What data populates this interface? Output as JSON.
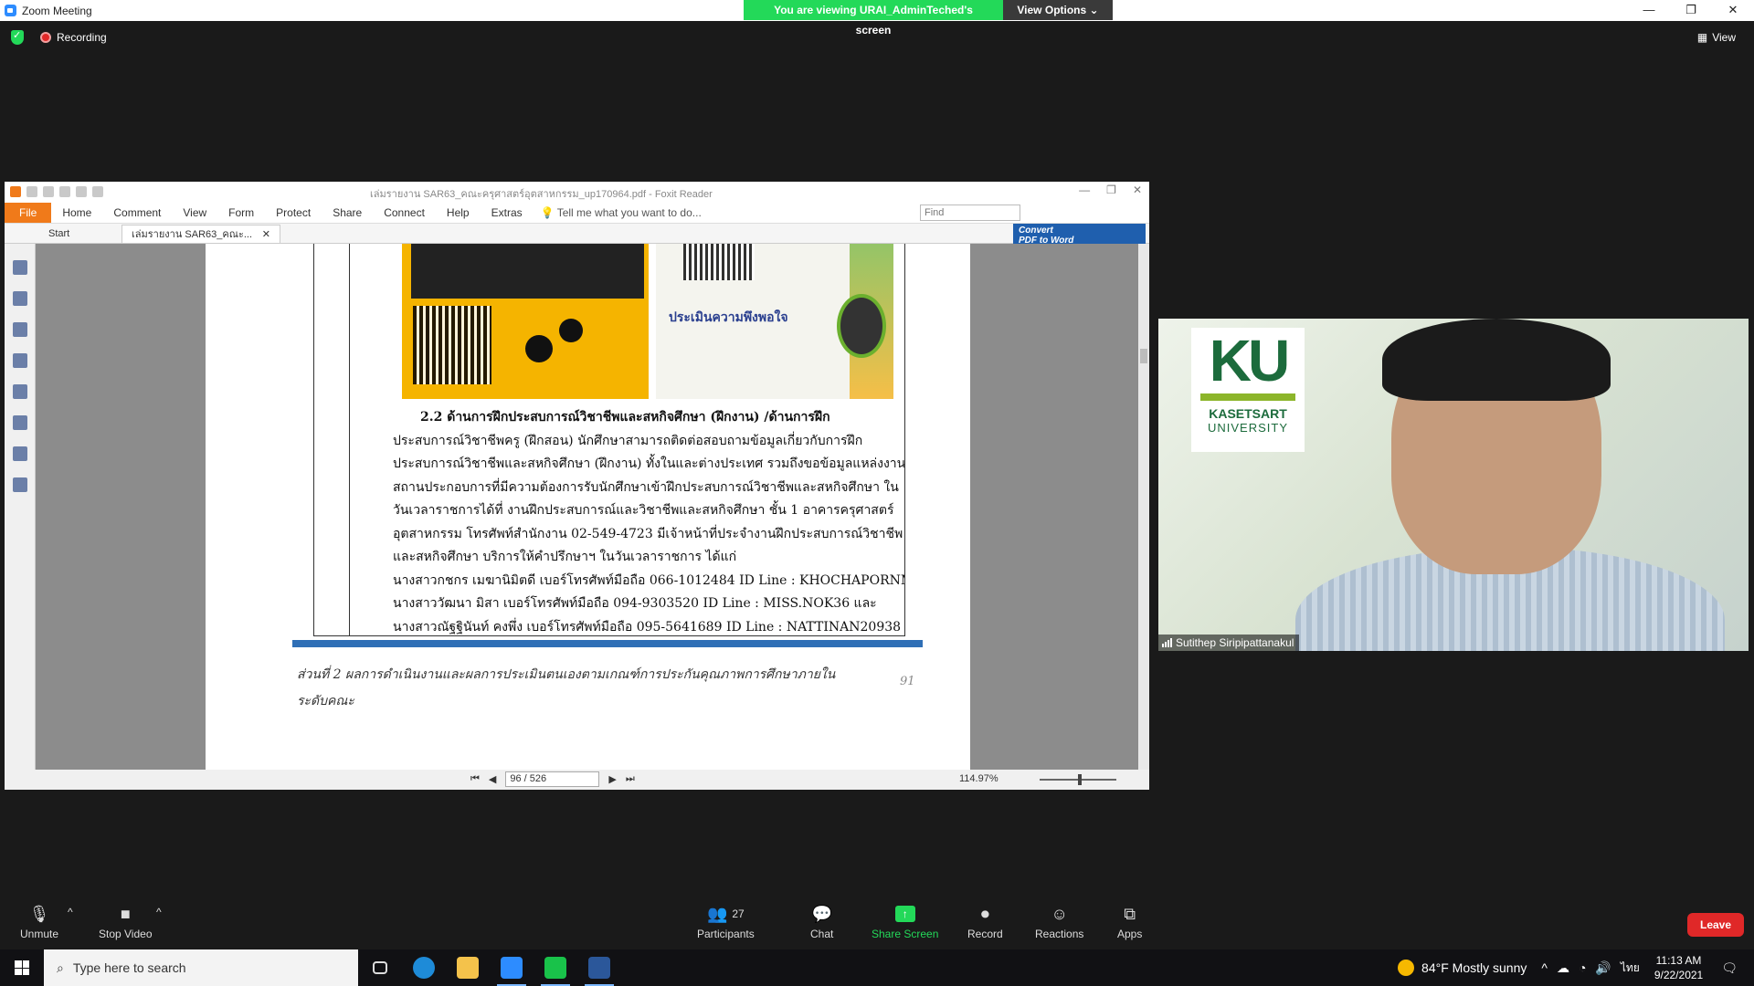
{
  "zoom": {
    "window_title": "Zoom Meeting",
    "share_banner": "You are viewing URAI_AdminTeched's screen",
    "view_options": "View Options",
    "recording_label": "Recording",
    "view_label": "View"
  },
  "foxit": {
    "title": "เล่มรายงาน SAR63_คณะครุศาสตร์อุตสาหกรรม_up170964.pdf - Foxit Reader",
    "menu": [
      "File",
      "Home",
      "Comment",
      "View",
      "Form",
      "Protect",
      "Share",
      "Connect",
      "Help",
      "Extras"
    ],
    "tell_me": "Tell me what you want to do...",
    "find_placeholder": "Find",
    "tabs": [
      {
        "label": "Start"
      },
      {
        "label": "เล่มรายงาน SAR63_คณะ..."
      }
    ],
    "convert_line1": "Convert",
    "convert_line2": "PDF to Word",
    "page_box": "96 / 526",
    "zoom_level": "114.97%"
  },
  "document": {
    "poster_right_headline": "ประเมินความพึงพอใจ",
    "lines": [
      "2.2 ด้านการฝึกประสบการณ์วิชาชีพและสหกิจศึกษา (ฝึกงาน) /ด้านการฝึก",
      "ประสบการณ์วิชาชีพครู (ฝึกสอน) นักศึกษาสามารถติดต่อสอบถามข้อมูลเกี่ยวกับการฝึก",
      "ประสบการณ์วิชาชีพและสหกิจศึกษา (ฝึกงาน) ทั้งในและต่างประเทศ รวมถึงขอข้อมูลแหล่งงาน",
      "สถานประกอบการที่มีความต้องการรับนักศึกษาเข้าฝึกประสบการณ์วิชาชีพและสหกิจศึกษา ใน",
      "วันเวลาราชการได้ที่ งานฝึกประสบการณ์และวิชาชีพและสหกิจศึกษา ชั้น 1 อาคารครุศาสตร์",
      "อุตสาหกรรม โทรศัพท์สำนักงาน 02-549-4723 มีเจ้าหน้าที่ประจำงานฝึกประสบการณ์วิชาชีพ",
      "และสหกิจศึกษา บริการให้คำปรึกษาฯ ในวันเวลาราชการ ได้แก่",
      "นางสาวกชกร เมฆานิมิตดี เบอร์โทรศัพท์มือถือ 066-1012484 ID Line : KHOCHAPORNM",
      "นางสาววัฒนา มิสา เบอร์โทรศัพท์มือถือ 094-9303520 ID Line : MISS.NOK36 และ",
      "นางสาวณัฐฐินันท์ คงพึ่ง เบอร์โทรศัพท์มือถือ 095-5641689 ID Line : NATTINAN20938"
    ],
    "footer_line1": "ส่วนที่ 2 ผลการดำเนินงานและผลการประเมินตนเองตามเกณฑ์การประกันคุณภาพการศึกษาภายใน",
    "footer_line2": "ระดับคณะ",
    "page_number": "91"
  },
  "video": {
    "logo_text": "KU",
    "logo_line1": "KASETSART",
    "logo_line2": "UNIVERSITY",
    "participant_name": "Sutithep Siripipattanakul"
  },
  "toolbar": {
    "unmute": "Unmute",
    "stop_video": "Stop Video",
    "participants": "Participants",
    "participants_count": "27",
    "chat": "Chat",
    "share_screen": "Share Screen",
    "record": "Record",
    "reactions": "Reactions",
    "apps": "Apps",
    "leave": "Leave"
  },
  "taskbar": {
    "search_placeholder": "Type here to search",
    "weather": "84°F  Mostly sunny",
    "lang": "ไทย",
    "time": "11:13 AM",
    "date": "9/22/2021"
  },
  "colors": {
    "zoom_green": "#23d959",
    "leave_red": "#e02828",
    "foxit_orange": "#f07a1a"
  }
}
